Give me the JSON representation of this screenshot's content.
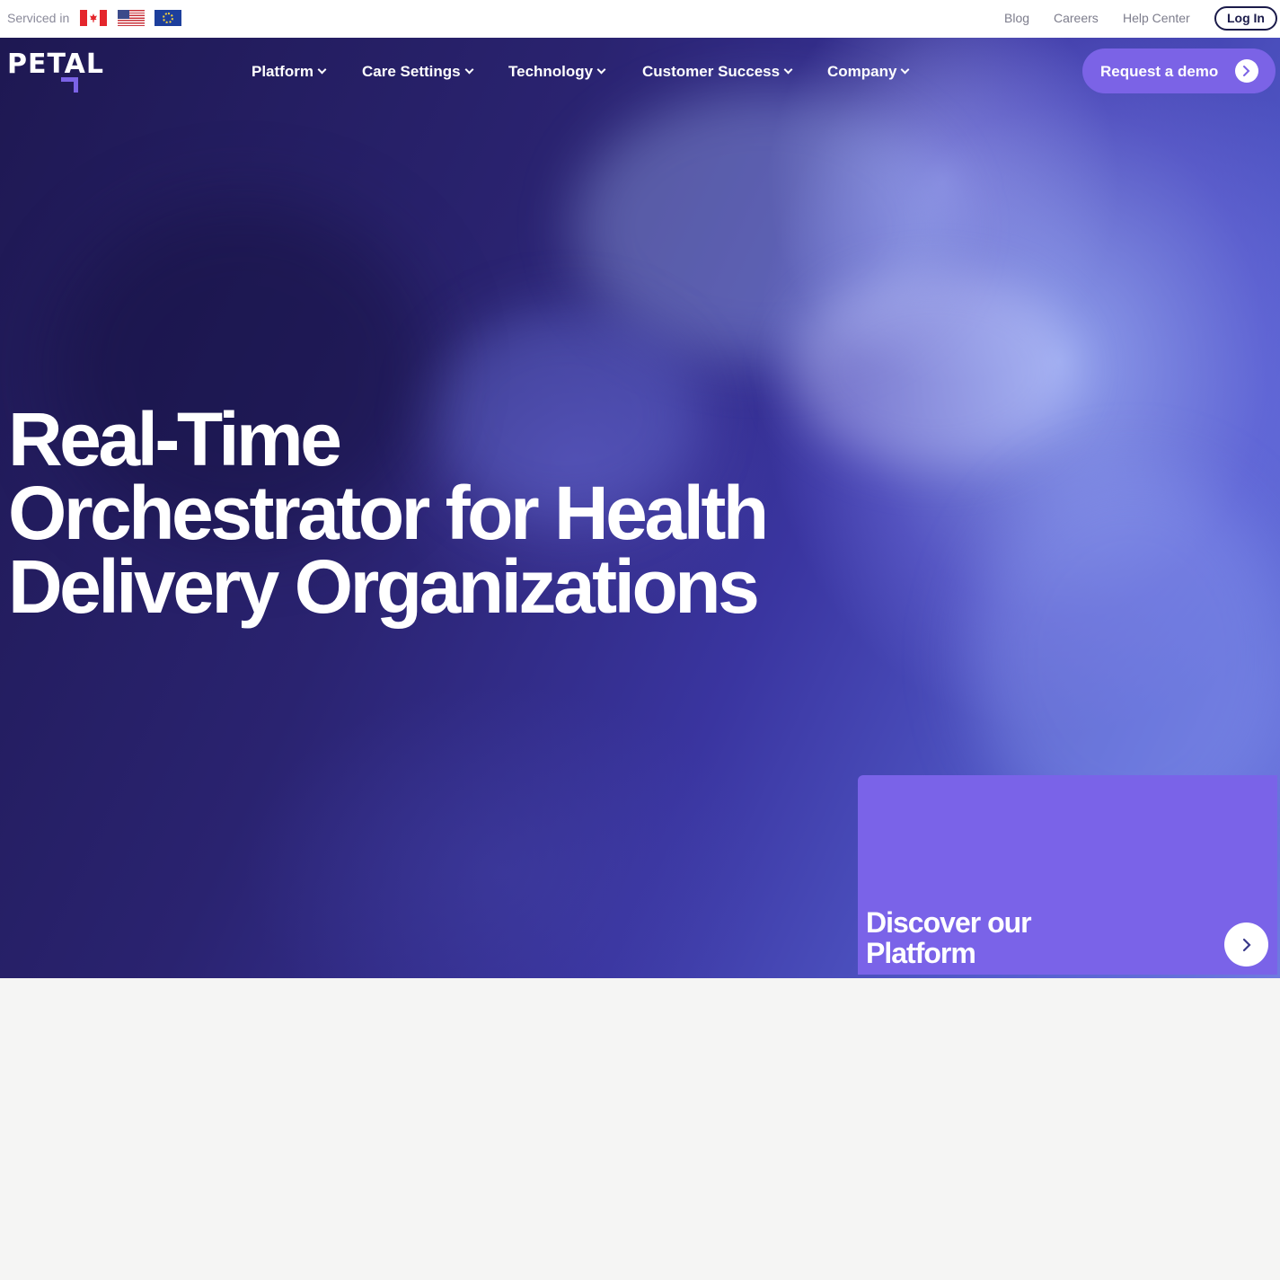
{
  "topbar": {
    "serviced_label": "Serviced in",
    "flags": [
      "canada-flag-icon",
      "usa-flag-icon",
      "eu-flag-icon"
    ],
    "links": [
      "Blog",
      "Careers",
      "Help Center"
    ],
    "login_label": "Log In"
  },
  "header": {
    "logo_text": "PETAL",
    "nav": [
      {
        "label": "Platform"
      },
      {
        "label": "Care Settings"
      },
      {
        "label": "Technology"
      },
      {
        "label": "Customer Success"
      },
      {
        "label": "Company"
      }
    ],
    "demo_label": "Request a demo"
  },
  "hero": {
    "headline_lines": [
      "Real-Time",
      "Orchestrator for Health",
      "Delivery Organizations"
    ]
  },
  "discover": {
    "title_lines": [
      "Discover our",
      "Platform"
    ]
  },
  "colors": {
    "accent": "#7b63e6",
    "hero_dark": "#1e1852",
    "text_dark": "#1b1b4a",
    "page_bg": "#f5f5f4"
  }
}
